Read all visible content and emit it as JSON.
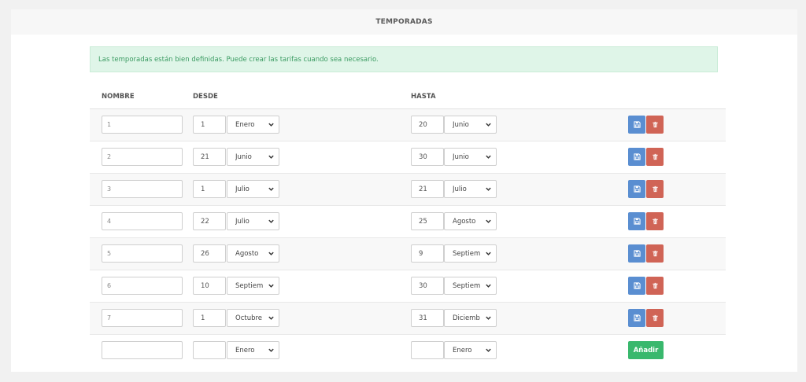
{
  "header": {
    "title": "TEMPORADAS"
  },
  "alert": {
    "message": "Las temporadas están bien definidas. Puede crear las tarifas cuando sea necesario."
  },
  "table": {
    "columns": {
      "nombre": "NOMBRE",
      "desde": "DESDE",
      "hasta": "HASTA"
    },
    "rows": [
      {
        "name": "1",
        "from_day": "1",
        "from_month": "Enero",
        "to_day": "20",
        "to_month": "Junio"
      },
      {
        "name": "2",
        "from_day": "21",
        "from_month": "Junio",
        "to_day": "30",
        "to_month": "Junio"
      },
      {
        "name": "3",
        "from_day": "1",
        "from_month": "Julio",
        "to_day": "21",
        "to_month": "Julio"
      },
      {
        "name": "4",
        "from_day": "22",
        "from_month": "Julio",
        "to_day": "25",
        "to_month": "Agosto"
      },
      {
        "name": "5",
        "from_day": "26",
        "from_month": "Agosto",
        "to_day": "9",
        "to_month": "Septiem"
      },
      {
        "name": "6",
        "from_day": "10",
        "from_month": "Septiem",
        "to_day": "30",
        "to_month": "Septiem"
      },
      {
        "name": "7",
        "from_day": "1",
        "from_month": "Octubre",
        "to_day": "31",
        "to_month": "Diciemb"
      }
    ],
    "new_row": {
      "name": "",
      "from_day": "",
      "from_month": "Enero",
      "to_day": "",
      "to_month": "Enero",
      "add_label": "Añadir"
    }
  },
  "icons": {
    "save": "floppy-disk-icon",
    "delete": "trash-icon",
    "dropdown": "chevron-down-icon"
  },
  "colors": {
    "save": "#5a8ed1",
    "delete": "#d06456",
    "add": "#39b86d",
    "alert_bg": "#dff5e8",
    "alert_text": "#3b9b62"
  }
}
